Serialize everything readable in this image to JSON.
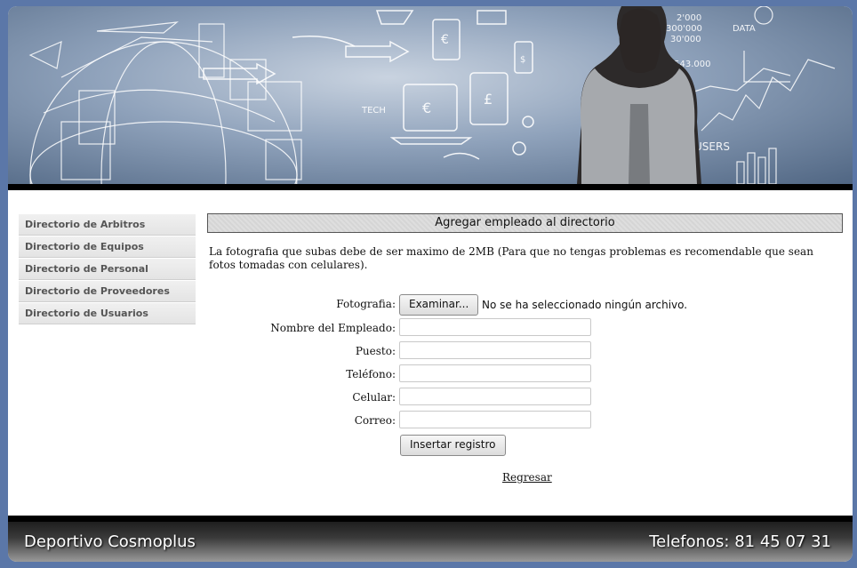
{
  "sidebar": {
    "items": [
      {
        "label": "Directorio de Arbitros"
      },
      {
        "label": "Directorio de Equipos"
      },
      {
        "label": "Directorio de Personal"
      },
      {
        "label": "Directorio de Proveedores"
      },
      {
        "label": "Directorio de Usuarios"
      }
    ]
  },
  "main": {
    "title": "Agregar empleado al directorio",
    "intro": "La fotografia que subas debe de ser maximo de 2MB (Para que no tengas problemas es recomendable que sean fotos tomadas con celulares).",
    "form": {
      "photo_label": "Fotografia:",
      "browse_label": "Examinar...",
      "file_status": "No se ha seleccionado ningún archivo.",
      "fields": [
        {
          "label": "Nombre del Empleado:",
          "value": ""
        },
        {
          "label": "Puesto:",
          "value": ""
        },
        {
          "label": "Teléfono:",
          "value": ""
        },
        {
          "label": "Celular:",
          "value": ""
        },
        {
          "label": "Correo:",
          "value": ""
        }
      ],
      "submit_label": "Insertar registro"
    },
    "back_link": "Regresar"
  },
  "banner": {
    "texts": [
      "TECH",
      "DATA",
      "USERS",
      "2'000",
      "300'000",
      "30'000",
      "2'543.000"
    ]
  },
  "footer": {
    "left": "Deportivo Cosmoplus",
    "right": "Telefonos: 81 45 07 31"
  },
  "colors": {
    "page_bg": "#5b77a8",
    "banner_base": "#8fa2bb",
    "bar": "#000000"
  }
}
